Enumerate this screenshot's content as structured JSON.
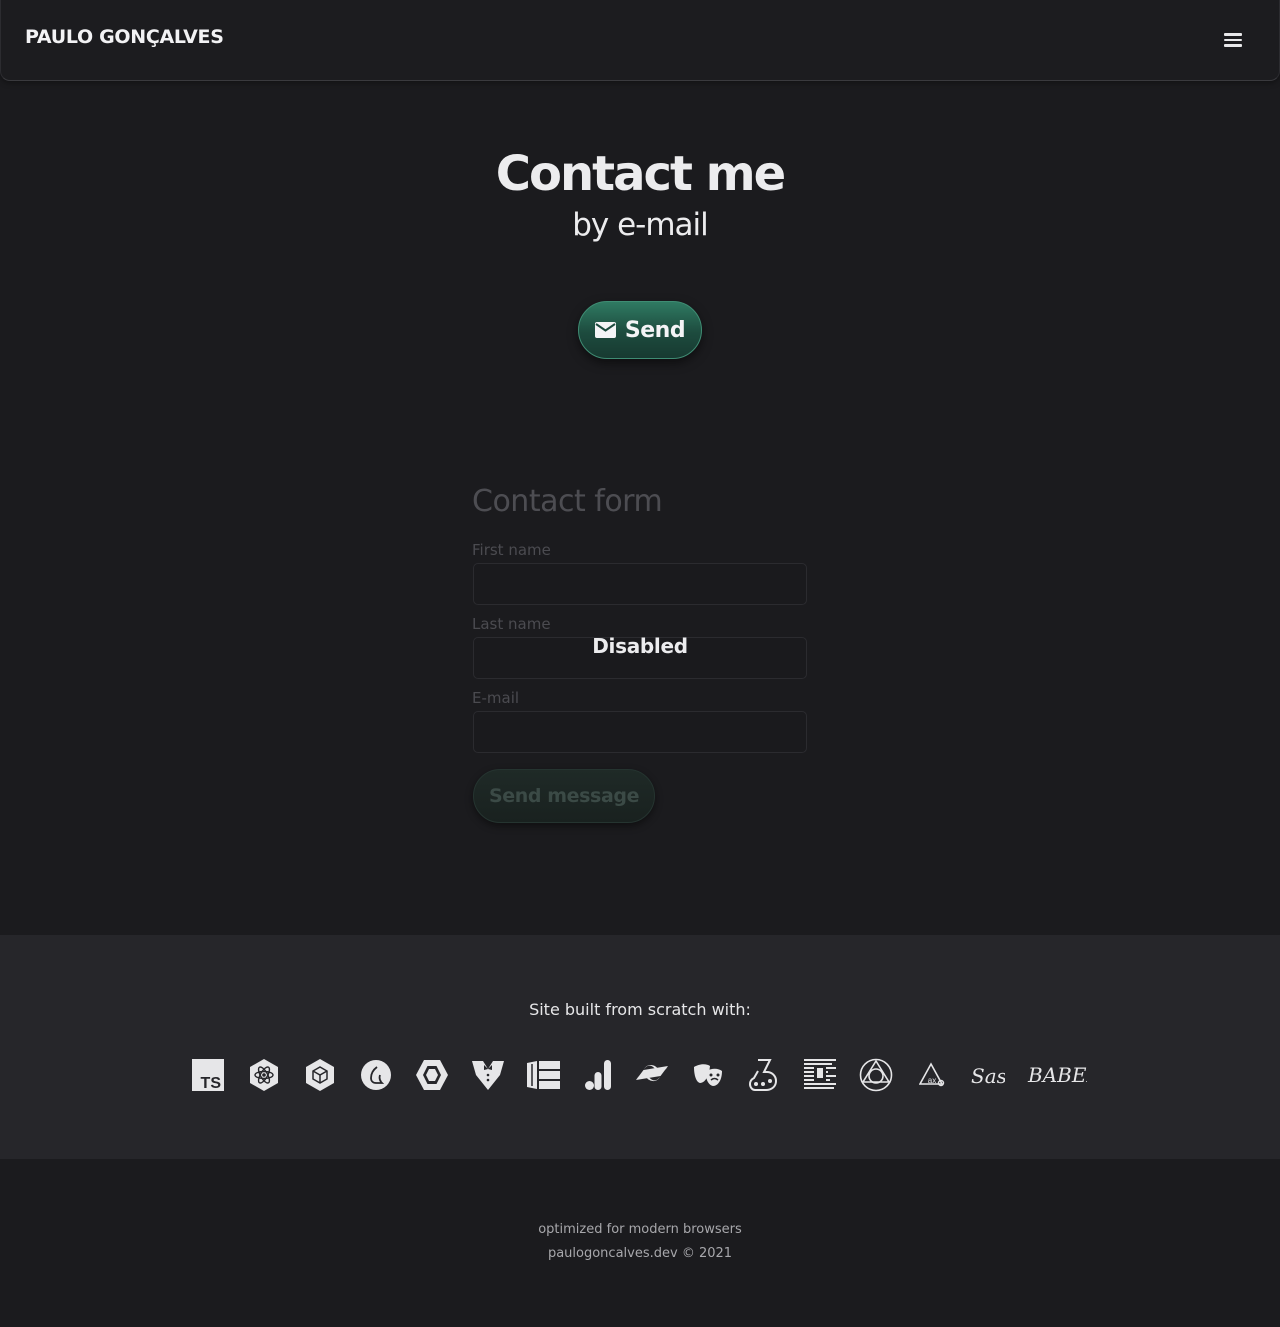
{
  "header": {
    "brand": "PAULO GONÇALVES",
    "menu_icon": "hamburger-menu-icon"
  },
  "hero": {
    "title": "Contact me",
    "subtitle": "by e-mail",
    "send_button": {
      "icon": "mail-icon",
      "label": "Send",
      "colors": {
        "from": "#2f7a62",
        "to": "#173a31"
      }
    }
  },
  "contact_form": {
    "title": "Contact form",
    "fields": [
      {
        "label": "First name",
        "value": ""
      },
      {
        "label": "Last name",
        "value": ""
      },
      {
        "label": "E-mail",
        "value": ""
      }
    ],
    "overlay_text": "Disabled",
    "submit_label": "Send message",
    "state": "disabled"
  },
  "tech_stack": {
    "title": "Site built from scratch with:",
    "icons": [
      "typescript-icon",
      "react-icon",
      "webpack-icon",
      "prettier-icon",
      "eslint-icon",
      "gatsby-tuxedo-icon",
      "web-components-icon",
      "google-analytics-icon",
      "tailwind-icon",
      "theatre-masks-icon",
      "jest-icon",
      "storybook-icon",
      "glyph-compass-icon",
      "axe-icon",
      "sass-icon",
      "babel-icon"
    ],
    "sass_text": "Sass",
    "babel_text": "BABEL",
    "ts_text": "TS"
  },
  "footer": {
    "line1": "optimized for modern browsers",
    "line2": "paulogoncalves.dev © 2021"
  },
  "colors": {
    "background": "#1b1b1e",
    "tech_background": "#26262a",
    "accent": "#2f7a62"
  }
}
